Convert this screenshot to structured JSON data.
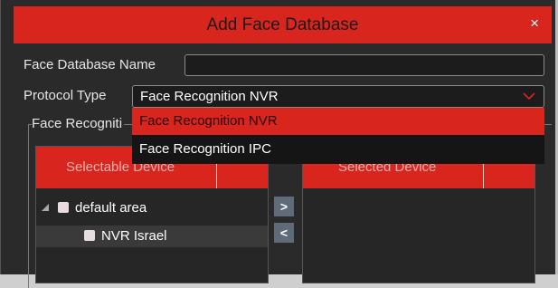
{
  "dialog": {
    "title": "Add Face Database",
    "close_glyph": "×"
  },
  "form": {
    "name_label": "Face Database Name",
    "name_value": "",
    "protocol_label": "Protocol Type",
    "protocol_value": "Face Recognition NVR",
    "protocol_options": [
      "Face Recognition NVR",
      "Face Recognition IPC"
    ],
    "group_label": "Face Recogniti"
  },
  "selectable": {
    "header": "Selectable Device",
    "tree": [
      {
        "label": "default area",
        "expanded": true
      },
      {
        "label": "NVR Israel"
      }
    ]
  },
  "selected": {
    "header": "Selected Device"
  },
  "buttons": {
    "add_glyph": ">",
    "remove_glyph": "<"
  },
  "colors": {
    "accent": "#d8261f",
    "background": "#2a2a2a",
    "arrow_button": "#5f6b78"
  }
}
